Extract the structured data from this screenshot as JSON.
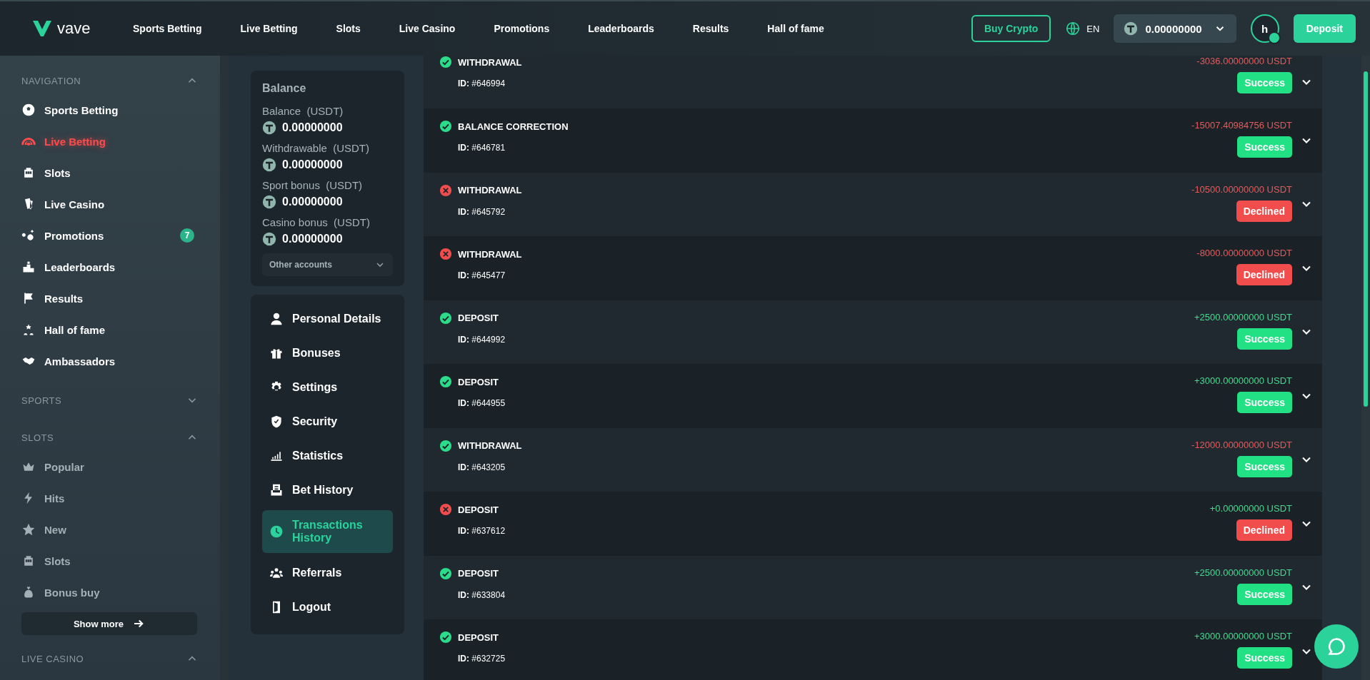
{
  "header": {
    "logo": "vave",
    "nav": [
      "Sports Betting",
      "Live Betting",
      "Slots",
      "Live Casino",
      "Promotions",
      "Leaderboards",
      "Results",
      "Hall of fame"
    ],
    "buy_crypto": "Buy Crypto",
    "language": "EN",
    "wallet_balance": "0.00000000",
    "avatar_letter": "h",
    "deposit": "Deposit"
  },
  "sidebar": {
    "sections": [
      {
        "title": "NAVIGATION",
        "expanded": true,
        "dim": false,
        "items": [
          {
            "label": "Sports Betting",
            "selected": false
          },
          {
            "label": "Live Betting",
            "selected": true
          },
          {
            "label": "Slots",
            "selected": false
          },
          {
            "label": "Live Casino",
            "selected": false
          },
          {
            "label": "Promotions",
            "selected": false,
            "badge": "7"
          },
          {
            "label": "Leaderboards",
            "selected": false
          },
          {
            "label": "Results",
            "selected": false
          },
          {
            "label": "Hall of fame",
            "selected": false
          },
          {
            "label": "Ambassadors",
            "selected": false
          }
        ]
      },
      {
        "title": "SPORTS",
        "expanded": false
      },
      {
        "title": "SLOTS",
        "expanded": true,
        "dim": true,
        "items": [
          {
            "label": "Popular",
            "selected": false
          },
          {
            "label": "Hits",
            "selected": false
          },
          {
            "label": "New",
            "selected": false
          },
          {
            "label": "Slots",
            "selected": false
          },
          {
            "label": "Bonus buy",
            "selected": false
          }
        ],
        "show_more": "Show more"
      },
      {
        "title": "LIVE CASINO",
        "expanded": true
      }
    ]
  },
  "balance": {
    "title": "Balance",
    "accounts": [
      {
        "label": "Balance",
        "unit": "(USDT)",
        "value": "0.00000000"
      },
      {
        "label": "Withdrawable",
        "unit": "(USDT)",
        "value": "0.00000000"
      },
      {
        "label": "Sport bonus",
        "unit": "(USDT)",
        "value": "0.00000000"
      },
      {
        "label": "Casino bonus",
        "unit": "(USDT)",
        "value": "0.00000000"
      }
    ],
    "other_accounts": "Other accounts"
  },
  "account_menu": [
    {
      "label": "Personal Details",
      "selected": false
    },
    {
      "label": "Bonuses",
      "selected": false
    },
    {
      "label": "Settings",
      "selected": false
    },
    {
      "label": "Security",
      "selected": false
    },
    {
      "label": "Statistics",
      "selected": false
    },
    {
      "label": "Bet History",
      "selected": false
    },
    {
      "label": "Transactions History",
      "selected": true
    },
    {
      "label": "Referrals",
      "selected": false
    },
    {
      "label": "Logout",
      "selected": false
    }
  ],
  "transactions": [
    {
      "type": "WITHDRAWAL",
      "id": "**ID:** #646994",
      "amount": "-3036.00000000 USDT",
      "kind": "debit",
      "ok": true,
      "status": "Success"
    },
    {
      "type": "BALANCE CORRECTION",
      "id": "**ID:** #646781",
      "amount": "-15007.40984756 USDT",
      "kind": "debit",
      "ok": true,
      "status": "Success"
    },
    {
      "type": "WITHDRAWAL",
      "id": "**ID:** #645792",
      "amount": "-10500.00000000 USDT",
      "kind": "debit",
      "ok": false,
      "status": "Declined"
    },
    {
      "type": "WITHDRAWAL",
      "id": "**ID:** #645477",
      "amount": "-8000.00000000 USDT",
      "kind": "debit",
      "ok": false,
      "status": "Declined"
    },
    {
      "type": "DEPOSIT",
      "id": "**ID:** #644992",
      "amount": "+2500.00000000 USDT",
      "kind": "credit",
      "ok": true,
      "status": "Success"
    },
    {
      "type": "DEPOSIT",
      "id": "**ID:** #644955",
      "amount": "+3000.00000000 USDT",
      "kind": "credit",
      "ok": true,
      "status": "Success"
    },
    {
      "type": "WITHDRAWAL",
      "id": "**ID:** #643205",
      "amount": "-12000.00000000 USDT",
      "kind": "debit",
      "ok": true,
      "status": "Success"
    },
    {
      "type": "DEPOSIT",
      "id": "**ID:** #637612",
      "amount": "+0.00000000 USDT",
      "kind": "credit",
      "ok": false,
      "status": "Declined"
    },
    {
      "type": "DEPOSIT",
      "id": "**ID:** #633804",
      "amount": "+2500.00000000 USDT",
      "kind": "credit",
      "ok": true,
      "status": "Success"
    },
    {
      "type": "DEPOSIT",
      "id": "**ID:** #632725",
      "amount": "+3000.00000000 USDT",
      "kind": "credit",
      "ok": true,
      "status": "Success"
    }
  ]
}
